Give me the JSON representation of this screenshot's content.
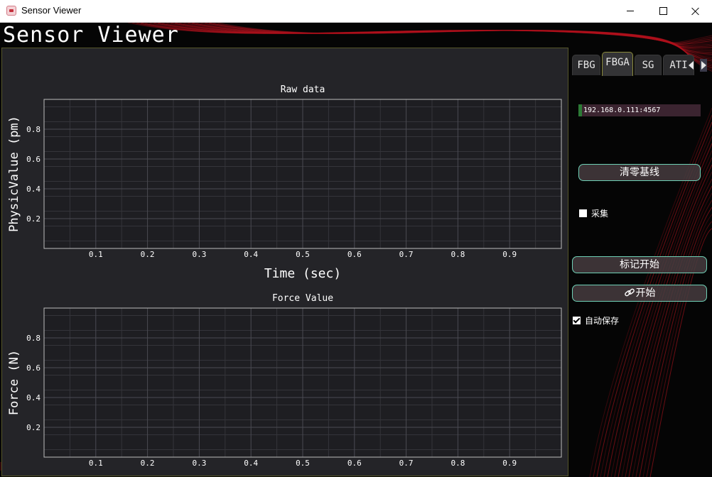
{
  "window": {
    "title": "Sensor Viewer"
  },
  "app": {
    "heading": "Sensor Viewer"
  },
  "colors": {
    "accent": "#6fd0b6",
    "panel": "#242428",
    "wave": "#b0121d",
    "address_indicator": "#2c7a36"
  },
  "chart_data": [
    {
      "type": "line",
      "title": "Raw data",
      "xlabel": "Time (sec)",
      "ylabel": "PhysicValue (pm)",
      "xlim": [
        0,
        1
      ],
      "ylim": [
        0,
        1
      ],
      "xticks": [
        0.1,
        0.2,
        0.3,
        0.4,
        0.5,
        0.6,
        0.7,
        0.8,
        0.9
      ],
      "yticks": [
        0.2,
        0.4,
        0.6,
        0.8
      ],
      "xtick_labels": [
        "0.1",
        "0.2",
        "0.3",
        "0.4",
        "0.5",
        "0.6",
        "0.7",
        "0.8",
        "0.9"
      ],
      "ytick_labels": [
        "0.2",
        "0.4",
        "0.6",
        "0.8"
      ],
      "grid": true,
      "series": []
    },
    {
      "type": "line",
      "title": "Force Value",
      "xlabel": "Time (sec)",
      "ylabel": "Force (N)",
      "xlim": [
        0,
        1
      ],
      "ylim": [
        0,
        1
      ],
      "xticks": [
        0.1,
        0.2,
        0.3,
        0.4,
        0.5,
        0.6,
        0.7,
        0.8,
        0.9
      ],
      "yticks": [
        0.2,
        0.4,
        0.6,
        0.8
      ],
      "xtick_labels": [
        "0.1",
        "0.2",
        "0.3",
        "0.4",
        "0.5",
        "0.6",
        "0.7",
        "0.8",
        "0.9"
      ],
      "ytick_labels": [
        "0.2",
        "0.4",
        "0.6",
        "0.8"
      ],
      "grid": true,
      "series": []
    }
  ],
  "tabs": [
    {
      "label": "FBG",
      "active": false
    },
    {
      "label": "FBGA",
      "active": true
    },
    {
      "label": "SG",
      "active": false
    },
    {
      "label": "ATI",
      "active": false
    }
  ],
  "address": "192.168.0.111:4567",
  "buttons": {
    "zero_baseline": "清零基线",
    "mark_start": "标记开始",
    "start": "开始"
  },
  "checkboxes": {
    "collect": {
      "label": "采集",
      "checked": false
    },
    "auto_save": {
      "label": "自动保存",
      "checked": true
    }
  }
}
